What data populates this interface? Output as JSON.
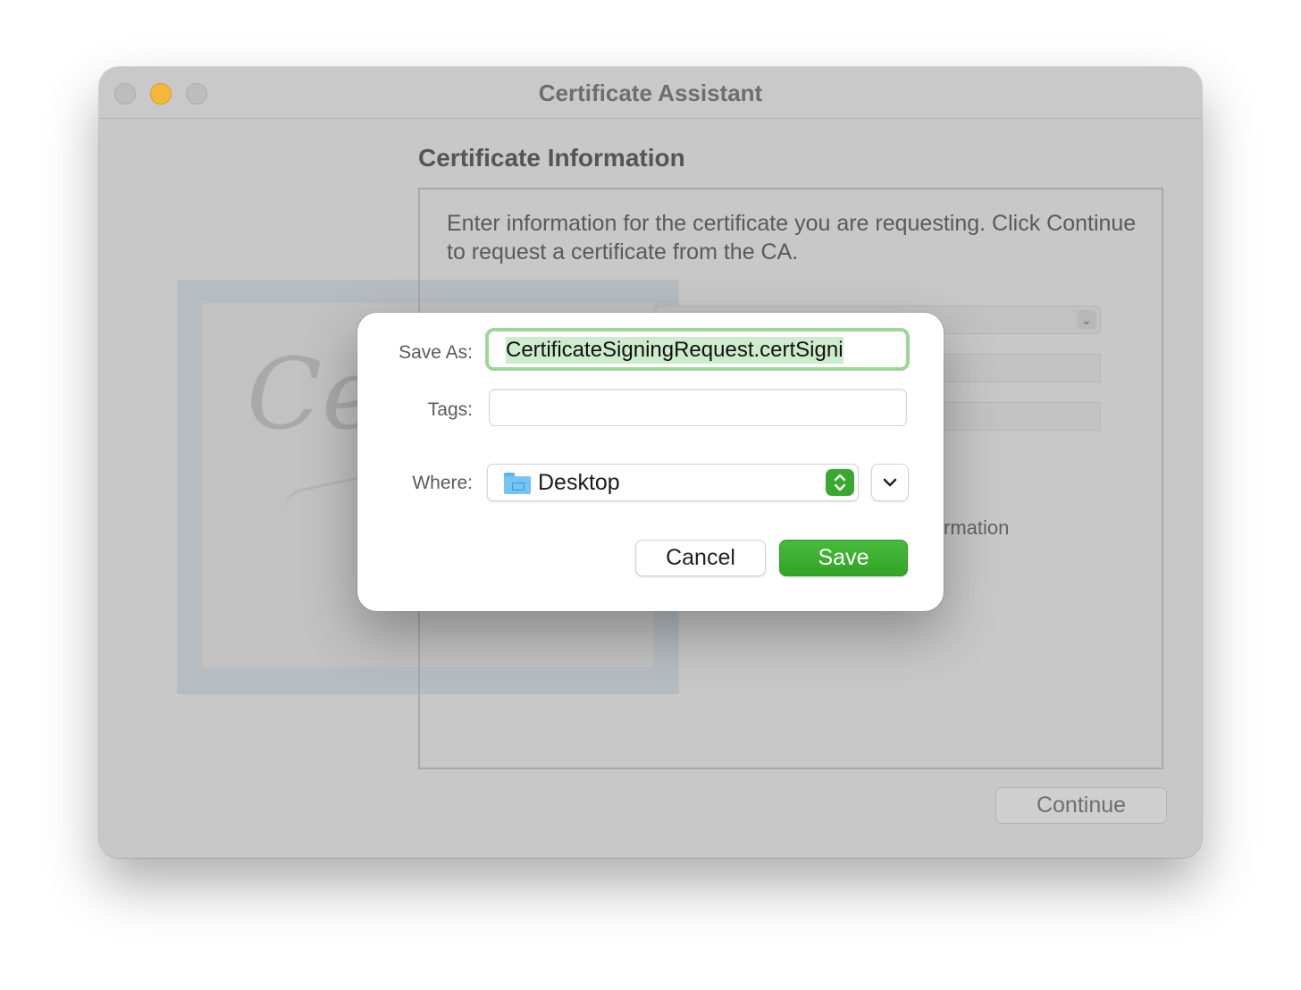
{
  "window": {
    "title": "Certificate Assistant",
    "section_heading": "Certificate Information",
    "intro_text": "Enter information for the certificate you are requesting. Click Continue to request a certificate from the CA.",
    "partial_visible_text": "rmation",
    "continue_label": "Continue",
    "certificate_art_text": "Ce"
  },
  "sheet": {
    "save_as_label": "Save As:",
    "save_as_value": "CertificateSigningRequest.certSigni",
    "tags_label": "Tags:",
    "tags_value": "",
    "where_label": "Where:",
    "where_value": "Desktop",
    "where_icon": "folder-icon",
    "cancel_label": "Cancel",
    "save_label": "Save"
  },
  "colors": {
    "accent": "#3aa82d",
    "focus_ring": "#9fd49a",
    "selection": "#cdeccb"
  }
}
